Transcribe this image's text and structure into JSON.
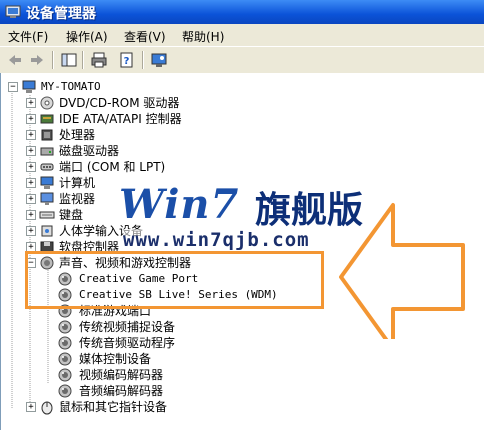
{
  "window": {
    "title": "设备管理器"
  },
  "menu": {
    "file": "文件(F)",
    "action": "操作(A)",
    "view": "查看(V)",
    "help": "帮助(H)"
  },
  "tree": {
    "root": "MY-TOMATO",
    "items": [
      {
        "label": "DVD/CD-ROM 驱动器",
        "icon": "cdrom-icon"
      },
      {
        "label": "IDE ATA/ATAPI 控制器",
        "icon": "ide-controller-icon"
      },
      {
        "label": "处理器",
        "icon": "processor-icon"
      },
      {
        "label": "磁盘驱动器",
        "icon": "disk-drive-icon"
      },
      {
        "label": "端口 (COM 和 LPT)",
        "icon": "port-icon"
      },
      {
        "label": "计算机",
        "icon": "computer-icon"
      },
      {
        "label": "监视器",
        "icon": "monitor-icon"
      },
      {
        "label": "键盘",
        "icon": "keyboard-icon"
      },
      {
        "label": "人体学输入设备",
        "icon": "hid-icon"
      },
      {
        "label": "软盘控制器",
        "icon": "floppy-controller-icon"
      },
      {
        "label": "声音、视频和游戏控制器",
        "icon": "sound-icon"
      }
    ],
    "sound_children": [
      "Creative Game Port",
      "Creative SB Live! Series (WDM)",
      "标准游戏端口",
      "传统视频捕捉设备",
      "传统音频驱动程序",
      "媒体控制设备",
      "视频编码解码器",
      "音频编码解码器"
    ],
    "last_item": "鼠标和其它指针设备"
  },
  "watermark": {
    "logo": "Win7",
    "cn": "旗舰版",
    "url": "www.win7qjb.com"
  },
  "colors": {
    "highlight": "#f39633",
    "titlebar": "#0b53d8"
  }
}
